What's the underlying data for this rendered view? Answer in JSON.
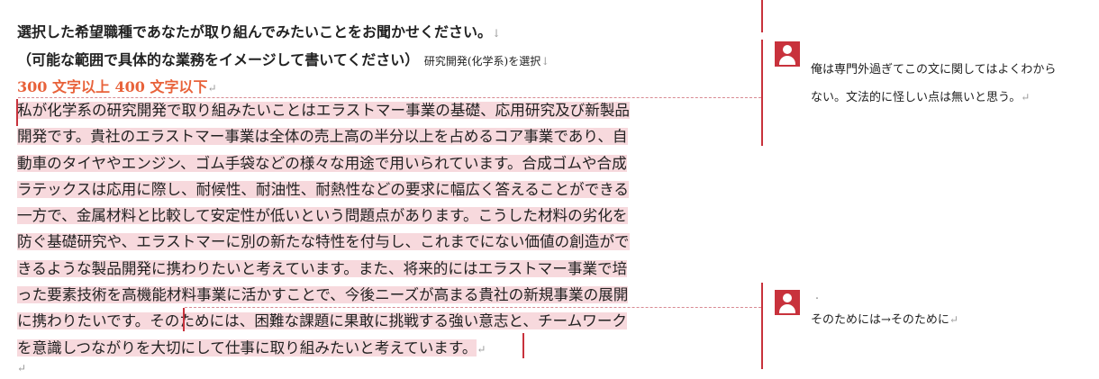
{
  "document": {
    "question_line1": "選択した希望職種であなたが取り組んでみたいことをお聞かせください。",
    "question_line2": "（可能な範囲で具体的な業務をイメージして書いてください）",
    "question_note": "研究開発(化学系)を選択",
    "requirement": "300 文字以上 400 文字以下",
    "arrow_mark": "↓",
    "return_mark": "↵",
    "body_part1": "私が化学系の研究開発で取り組みたいことはエラストマー事業の基礎、応用研究及び新製品開発です。貴社のエラストマー事業は全体の売上高の半分以上を占めるコア事業であり、自動車のタイヤやエンジン、ゴム手袋などの様々な用途で用いられています。合成ゴムや合成ラテックスは応用に際し、耐候性、耐油性、耐熱性などの要求に幅広く答えることができる一方で、金属材料と比較して安定性が低いという問題点があります。こうした材料の劣化を防ぐ基礎研究や、エラストマーに別の新たな特性を付与し、これまでにない価値の創造ができるような製品開発に携わりたいと考えています。また、将来的にはエラストマー事業で培った要素技術を高機能材料事業に活かすことで、今後ニーズが高まる貴社の新規事業の展開に携わりたいです。",
    "body_part2": "そのためには、困難な課題に果敢に挑戦する強い意志と、チームワークを意識しつながりを大切にして仕事に取り組みたいと考えています。"
  },
  "comments": [
    {
      "text_line1": "俺は専門外過ぎてこの文に関してはよくわから",
      "text_line2": "ない。文法的に怪しい点は無いと思う。"
    },
    {
      "tiny": "・",
      "text_line1": "そのためには→そのために"
    }
  ],
  "colors": {
    "accent": "#c8323c",
    "highlight": "#f7d9dd",
    "requirement": "#e8623a"
  }
}
